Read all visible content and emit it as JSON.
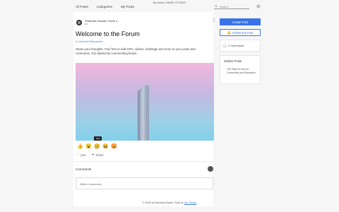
{
  "site": {
    "brand": "Business NAME STUDIO"
  },
  "nav": {
    "items": [
      "All Posts",
      "Categories",
      "My Posts"
    ]
  },
  "search": {
    "placeholder": "Search"
  },
  "post": {
    "author": "Shahzaib Hussain Yasrib",
    "author_meta": "Ad",
    "title": "Welcome to the Forum",
    "category": "in General Discussion",
    "body": "Share your thoughts. Feel free to add GIFs, videos, hashtags and more to your posts and comments. Get started by commenting below.",
    "tooltip": "Sad",
    "reactions": [
      "👍",
      "😮",
      "😢",
      "😆",
      "😡"
    ],
    "like_label": "Like",
    "share_label": "Share"
  },
  "comments": {
    "label": "Comments",
    "placeholder": "Write a comment..."
  },
  "sidebar": {
    "create_post": "Create Post",
    "follow_post": "Follow this Post",
    "comment_count": "0 comments",
    "similar_title": "Similar Posts",
    "similar_items": [
      "The Place for the Art Community and Discussion"
    ]
  },
  "footer": {
    "prefix": "© 2035 by Business Name. Built on ",
    "link": "Wix Studio"
  },
  "colors": {
    "accent": "#3874e8",
    "link": "#3b7bd6"
  }
}
